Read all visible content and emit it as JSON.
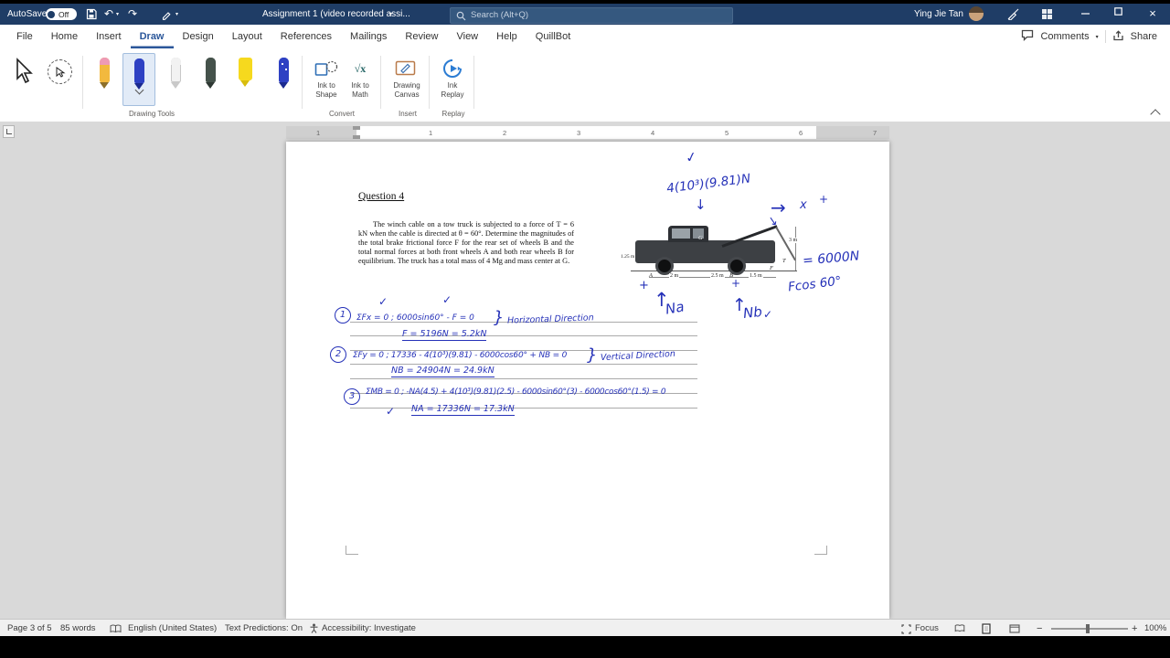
{
  "titlebar": {
    "autosave_label": "AutoSave",
    "autosave_state": "Off",
    "doc_title": "Assignment 1 (video recorded assi...",
    "search_placeholder": "Search (Alt+Q)",
    "user_name": "Ying Jie Tan"
  },
  "menubar": {
    "tabs": [
      "File",
      "Home",
      "Insert",
      "Draw",
      "Design",
      "Layout",
      "References",
      "Mailings",
      "Review",
      "View",
      "Help",
      "QuillBot"
    ],
    "comments_label": "Comments",
    "share_label": "Share"
  },
  "ribbon": {
    "ink_to_shape_l1": "Ink to",
    "ink_to_shape_l2": "Shape",
    "ink_to_math_l1": "Ink to",
    "ink_to_math_l2": "Math",
    "math_glyph": "√x",
    "drawing_canvas_l1": "Drawing",
    "drawing_canvas_l2": "Canvas",
    "ink_replay_l1": "Ink",
    "ink_replay_l2": "Replay",
    "groups": {
      "drawing_tools": "Drawing Tools",
      "convert": "Convert",
      "insert": "Insert",
      "replay": "Replay"
    }
  },
  "ruler": {
    "margin_number": "1",
    "numbers": [
      "1",
      "2",
      "3",
      "4",
      "5",
      "6",
      "7"
    ]
  },
  "document": {
    "heading": "Question 4",
    "body": "The winch cable on a tow truck is subjected to a force of T = 6 kN when the cable is directed at θ = 60°. Determine the magnitudes of the total brake frictional force F for the rear set of wheels B and the total normal forces at both front wheels A and both rear wheels B for equilibrium. The truck has a total mass of 4 Mg and mass center at G.",
    "figure": {
      "label_a": "A",
      "label_b": "B",
      "label_g": "G",
      "label_f": "F",
      "label_t": "T",
      "dim_left": "1.25 m",
      "dim_1": "2 m",
      "dim_2": "2.5 m",
      "dim_3": "1.5 m",
      "dim_right": "3 m"
    }
  },
  "ink": {
    "check": "✓",
    "weight": "4(10³)(9.81)N",
    "down_arrow": "↓",
    "right_arrow": "→",
    "x_label": "x",
    "plus": "+",
    "diag_arrow": "↘",
    "tension": "= 6000N",
    "fcos": "Fcos 60°",
    "up_arrow": "↑",
    "na_label": "Na",
    "nb_label": "Nb",
    "eq1_no": "1",
    "eq1": "ΣFx = 0 ;  6000sin60° - F = 0",
    "brace": "}",
    "eq1_note": "Horizontal Direction",
    "eq1_result": "F = 5196N = 5.2kN",
    "eq2_no": "2",
    "eq2": "ΣFy = 0 ;  17336 - 4(10³)(9.81) - 6000cos60° + NB = 0",
    "eq2_note": "Vertical Direction",
    "eq2_result": "NB = 24904N = 24.9kN",
    "eq3_no": "3",
    "eq3": "ΣMB = 0 ;  -NA(4.5) + 4(10³)(9.81)(2.5) - 6000sin60°(3) - 6000cos60°(1.5) = 0",
    "eq3_result": "NA = 17336N = 17.3kN"
  },
  "statusbar": {
    "page": "Page 3 of 5",
    "words": "85 words",
    "language": "English (United States)",
    "predictions": "Text Predictions: On",
    "accessibility": "Accessibility: Investigate",
    "focus": "Focus",
    "zoom_out": "−",
    "zoom_in": "+",
    "zoom_level": "100%"
  },
  "colors": {
    "titlebar": "#1f3d66",
    "accent": "#2b579a",
    "ink_blue": "#2531b8"
  }
}
